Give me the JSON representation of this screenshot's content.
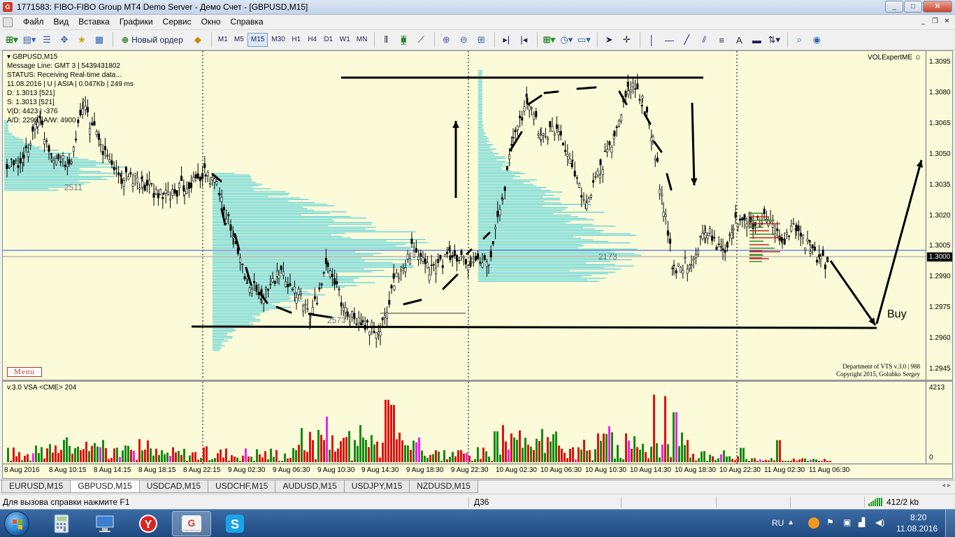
{
  "window": {
    "title": "1771583: FIBO-FIBO Group MT4 Demo Server - Демо Счет - [GBPUSD,M15]",
    "minimize": "_",
    "maximize": "□",
    "close": "✕"
  },
  "menu": {
    "items": [
      {
        "label": "Файл"
      },
      {
        "label": "Вид"
      },
      {
        "label": "Вставка"
      },
      {
        "label": "Графики"
      },
      {
        "label": "Сервис"
      },
      {
        "label": "Окно"
      },
      {
        "label": "Справка"
      }
    ]
  },
  "toolbar": {
    "new_order_label": "Новый ордер",
    "timeframes": [
      "M1",
      "M5",
      "M15",
      "M30",
      "H1",
      "H4",
      "D1",
      "W1",
      "MN"
    ],
    "active_timeframe": "M15"
  },
  "chart": {
    "symbol_title": "GBPUSD,M15",
    "info_lines": [
      "Message Line: GMT 3 | 5439431802",
      "STATUS:  Receiving Real-time data...",
      "11.08.2016 | U | ASIA | 0.047Kb | 249 ms",
      "D: 1.3013  [521]",
      "S: 1.3013  [521]",
      "V|D: 4423 | -376",
      "A/D: 2293 | A/W: 4900"
    ],
    "expert_name": "VOLExpertME",
    "menu_button": "Menu",
    "copyright_line1": "Department of VTS  v.3.0 | 988",
    "copyright_line2": "Copyright 2015, Golubko Sergey",
    "buy_annotation": "Buy",
    "profile_labels": [
      "2511",
      "2173",
      "2573"
    ],
    "price_labels": [
      "1.3095",
      "1.3080",
      "1.3065",
      "1.3050",
      "1.3035",
      "1.3020",
      "1.3005",
      "1.2990",
      "1.2975",
      "1.2960",
      "1.2945"
    ],
    "current_price": "1.3000",
    "indicator_title": "v.3.0 VSA <CME> 204",
    "indicator_max": "4213",
    "indicator_min": "0",
    "time_labels": [
      "8 Aug 2016",
      "8 Aug 10:15",
      "8 Aug 14:15",
      "8 Aug 18:15",
      "8 Aug 22:15",
      "9 Aug 02:30",
      "9 Aug 06:30",
      "9 Aug 10:30",
      "9 Aug 14:30",
      "9 Aug 18:30",
      "9 Aug 22:30",
      "10 Aug 02:30",
      "10 Aug 06:30",
      "10 Aug 10:30",
      "10 Aug 14:30",
      "10 Aug 18:30",
      "10 Aug 22:30",
      "11 Aug 02:30",
      "11 Aug 06:30"
    ],
    "colors": {
      "background": "#fbfbd9",
      "candle": "#000000",
      "profile": "#33c8d8",
      "bid_line": "#2a4fd8",
      "volume_up": "#138a13",
      "volume_down": "#e01010",
      "volume_special": "#ee22ee"
    }
  },
  "tabs": {
    "items": [
      "EURUSD,M15",
      "GBPUSD,M15",
      "USDCAD,M15",
      "USDCHF,M15",
      "AUDUSD,M15",
      "USDJPY,M15",
      "NZDUSD,M15"
    ],
    "active": "GBPUSD,M15"
  },
  "status": {
    "help": "Для вызова справки нажмите F1",
    "profile": "Д36",
    "traffic": "412/2 kb"
  },
  "taskbar": {
    "language": "RU",
    "time": "8:20",
    "date": "11.08.2016",
    "apps": [
      "calculator-app",
      "computer-app",
      "yandex-browser",
      "fibogroup-mt4",
      "skype"
    ]
  }
}
